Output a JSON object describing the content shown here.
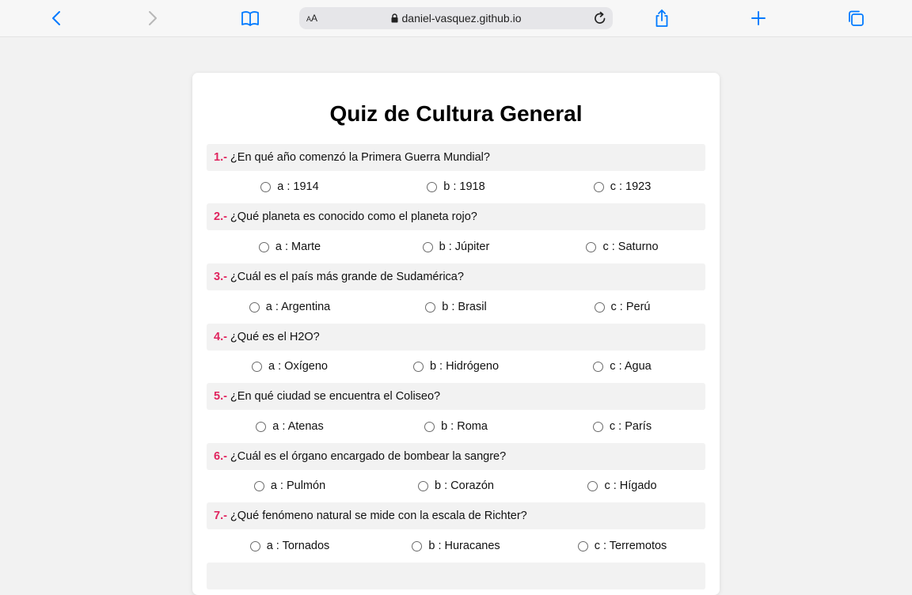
{
  "browser": {
    "url": "daniel-vasquez.github.io",
    "text_size_label_small": "A",
    "text_size_label_large": "A"
  },
  "quiz": {
    "title": "Quiz de Cultura General",
    "questions": [
      {
        "number": "1.-",
        "text": "¿En qué año comenzó la Primera Guerra Mundial?",
        "options": [
          "a : 1914",
          "b : 1918",
          "c : 1923"
        ]
      },
      {
        "number": "2.-",
        "text": "¿Qué planeta es conocido como el planeta rojo?",
        "options": [
          "a : Marte",
          "b : Júpiter",
          "c : Saturno"
        ]
      },
      {
        "number": "3.-",
        "text": "¿Cuál es el país más grande de Sudamérica?",
        "options": [
          "a : Argentina",
          "b : Brasil",
          "c : Perú"
        ]
      },
      {
        "number": "4.-",
        "text": "¿Qué es el H2O?",
        "options": [
          "a : Oxígeno",
          "b : Hidrógeno",
          "c : Agua"
        ]
      },
      {
        "number": "5.-",
        "text": "¿En qué ciudad se encuentra el Coliseo?",
        "options": [
          "a : Atenas",
          "b : Roma",
          "c : París"
        ]
      },
      {
        "number": "6.-",
        "text": "¿Cuál es el órgano encargado de bombear la sangre?",
        "options": [
          "a : Pulmón",
          "b : Corazón",
          "c : Hígado"
        ]
      },
      {
        "number": "7.-",
        "text": "¿Qué fenómeno natural se mide con la escala de Richter?",
        "options": [
          "a : Tornados",
          "b : Huracanes",
          "c : Terremotos"
        ]
      }
    ]
  },
  "colors": {
    "accent": "#007aff",
    "question_number": "#e0245e"
  }
}
